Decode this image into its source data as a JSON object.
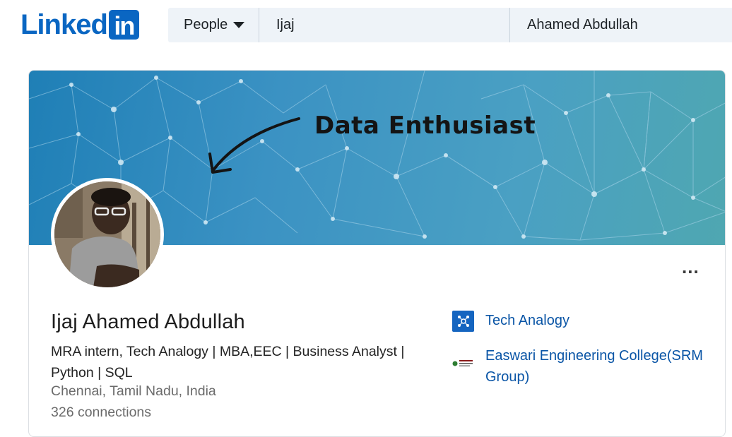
{
  "header": {
    "logo_text": "Linked",
    "logo_box_text": "in",
    "search": {
      "type_label": "People",
      "first_name": "Ijaj",
      "last_name": "Ahamed Abdullah"
    }
  },
  "profile": {
    "banner_text": "Data Enthusiast",
    "name": "Ijaj Ahamed Abdullah",
    "headline": "MRA intern, Tech Analogy | MBA,EEC | Business Analyst | Python | SQL",
    "location": "Chennai, Tamil Nadu, India",
    "connections": "326 connections",
    "more_label": "...",
    "organizations": [
      {
        "name": "Tech Analogy",
        "icon": "company-logo-icon"
      },
      {
        "name": "Easwari Engineering College(SRM Group)",
        "icon": "college-logo-icon"
      }
    ]
  },
  "colors": {
    "brand": "#0a66c2",
    "link": "#0a55a6",
    "search_bg": "#eef3f8",
    "banner": "#3b92c3"
  }
}
